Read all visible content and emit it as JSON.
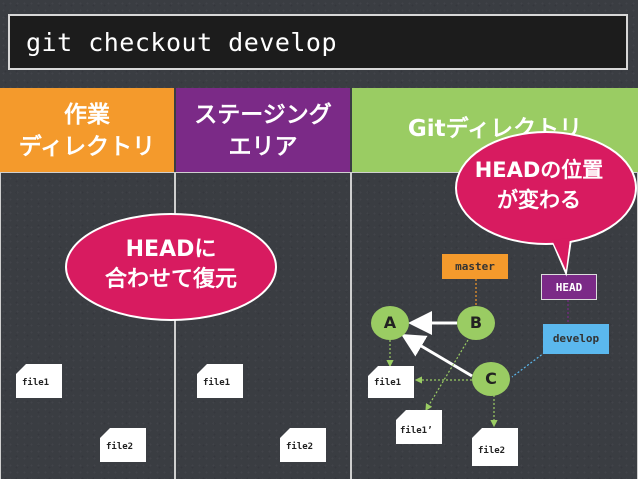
{
  "command": "git checkout develop",
  "columns": {
    "work": {
      "line1": "作業",
      "line2": "ディレクトリ"
    },
    "staging": {
      "line1": "ステージング",
      "line2": "エリア"
    },
    "git": {
      "label": "Gitディレクトリ"
    }
  },
  "callouts": {
    "restore": {
      "line1": "HEADに",
      "line2": "合わせて復元"
    },
    "head_moves": {
      "line1": "HEADの位置",
      "line2": "が変わる"
    }
  },
  "files": {
    "work_file1": "file1",
    "work_file2": "file2",
    "stage_file1": "file1",
    "stage_file2": "file2",
    "git_file1": "file1",
    "git_file1_prime": "file1’",
    "git_file2": "file2"
  },
  "graph": {
    "branches": {
      "master": "master",
      "head": "HEAD",
      "develop": "develop"
    },
    "commits": {
      "a": "A",
      "b": "B",
      "c": "C"
    }
  },
  "colors": {
    "work": "#f49a2c",
    "staging": "#7b2a87",
    "git": "#9acc63",
    "callout": "#d81b60",
    "master": "#f49a2c",
    "develop": "#5bb8ee",
    "head": "#7b2a87"
  }
}
